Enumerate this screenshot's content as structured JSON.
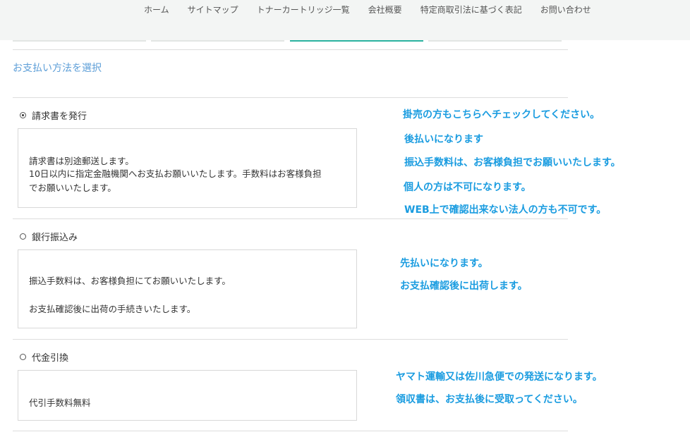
{
  "nav": {
    "items": [
      "ホーム",
      "サイトマップ",
      "トナーカートリッジ一覧",
      "会社概要",
      "特定商取引法に基づく表記",
      "お問い合わせ"
    ]
  },
  "section_title": "お支払い方法を選択",
  "options": [
    {
      "label": "請求書を発行",
      "checked": true,
      "lines": [
        "請求書は別途郵送します。",
        "10日以内に指定金融機関へお支払お願いいたします。手数料はお客様負担",
        "でお願いいたします。"
      ]
    },
    {
      "label": "銀行振込み",
      "checked": false,
      "lines": [
        "振込手数料は、お客様負担にてお願いいたします。",
        "お支払確認後に出荷の手続きいたします。"
      ]
    },
    {
      "label": "代金引換",
      "checked": false,
      "lines": [
        "代引手数料無料"
      ]
    }
  ],
  "notes": {
    "invoice": [
      "掛売の方もこちらへチェックしてください。",
      "後払いになります",
      "振込手数料は、お客様負担でお願いいたします。",
      "個人の方は不可になります。",
      "WEB上で確認出来ない法人の方も不可です。"
    ],
    "bank": [
      "先払いになります。",
      "お支払確認後に出荷します。"
    ],
    "cod": [
      "ヤマト運輸又は佐川急便での発送になります。",
      "領収書は、お支払後に受取ってください。"
    ]
  },
  "colors": {
    "accent": "#1a9ce0",
    "section_title": "#5e9fd8",
    "active_tab": "#2bb3a0"
  }
}
